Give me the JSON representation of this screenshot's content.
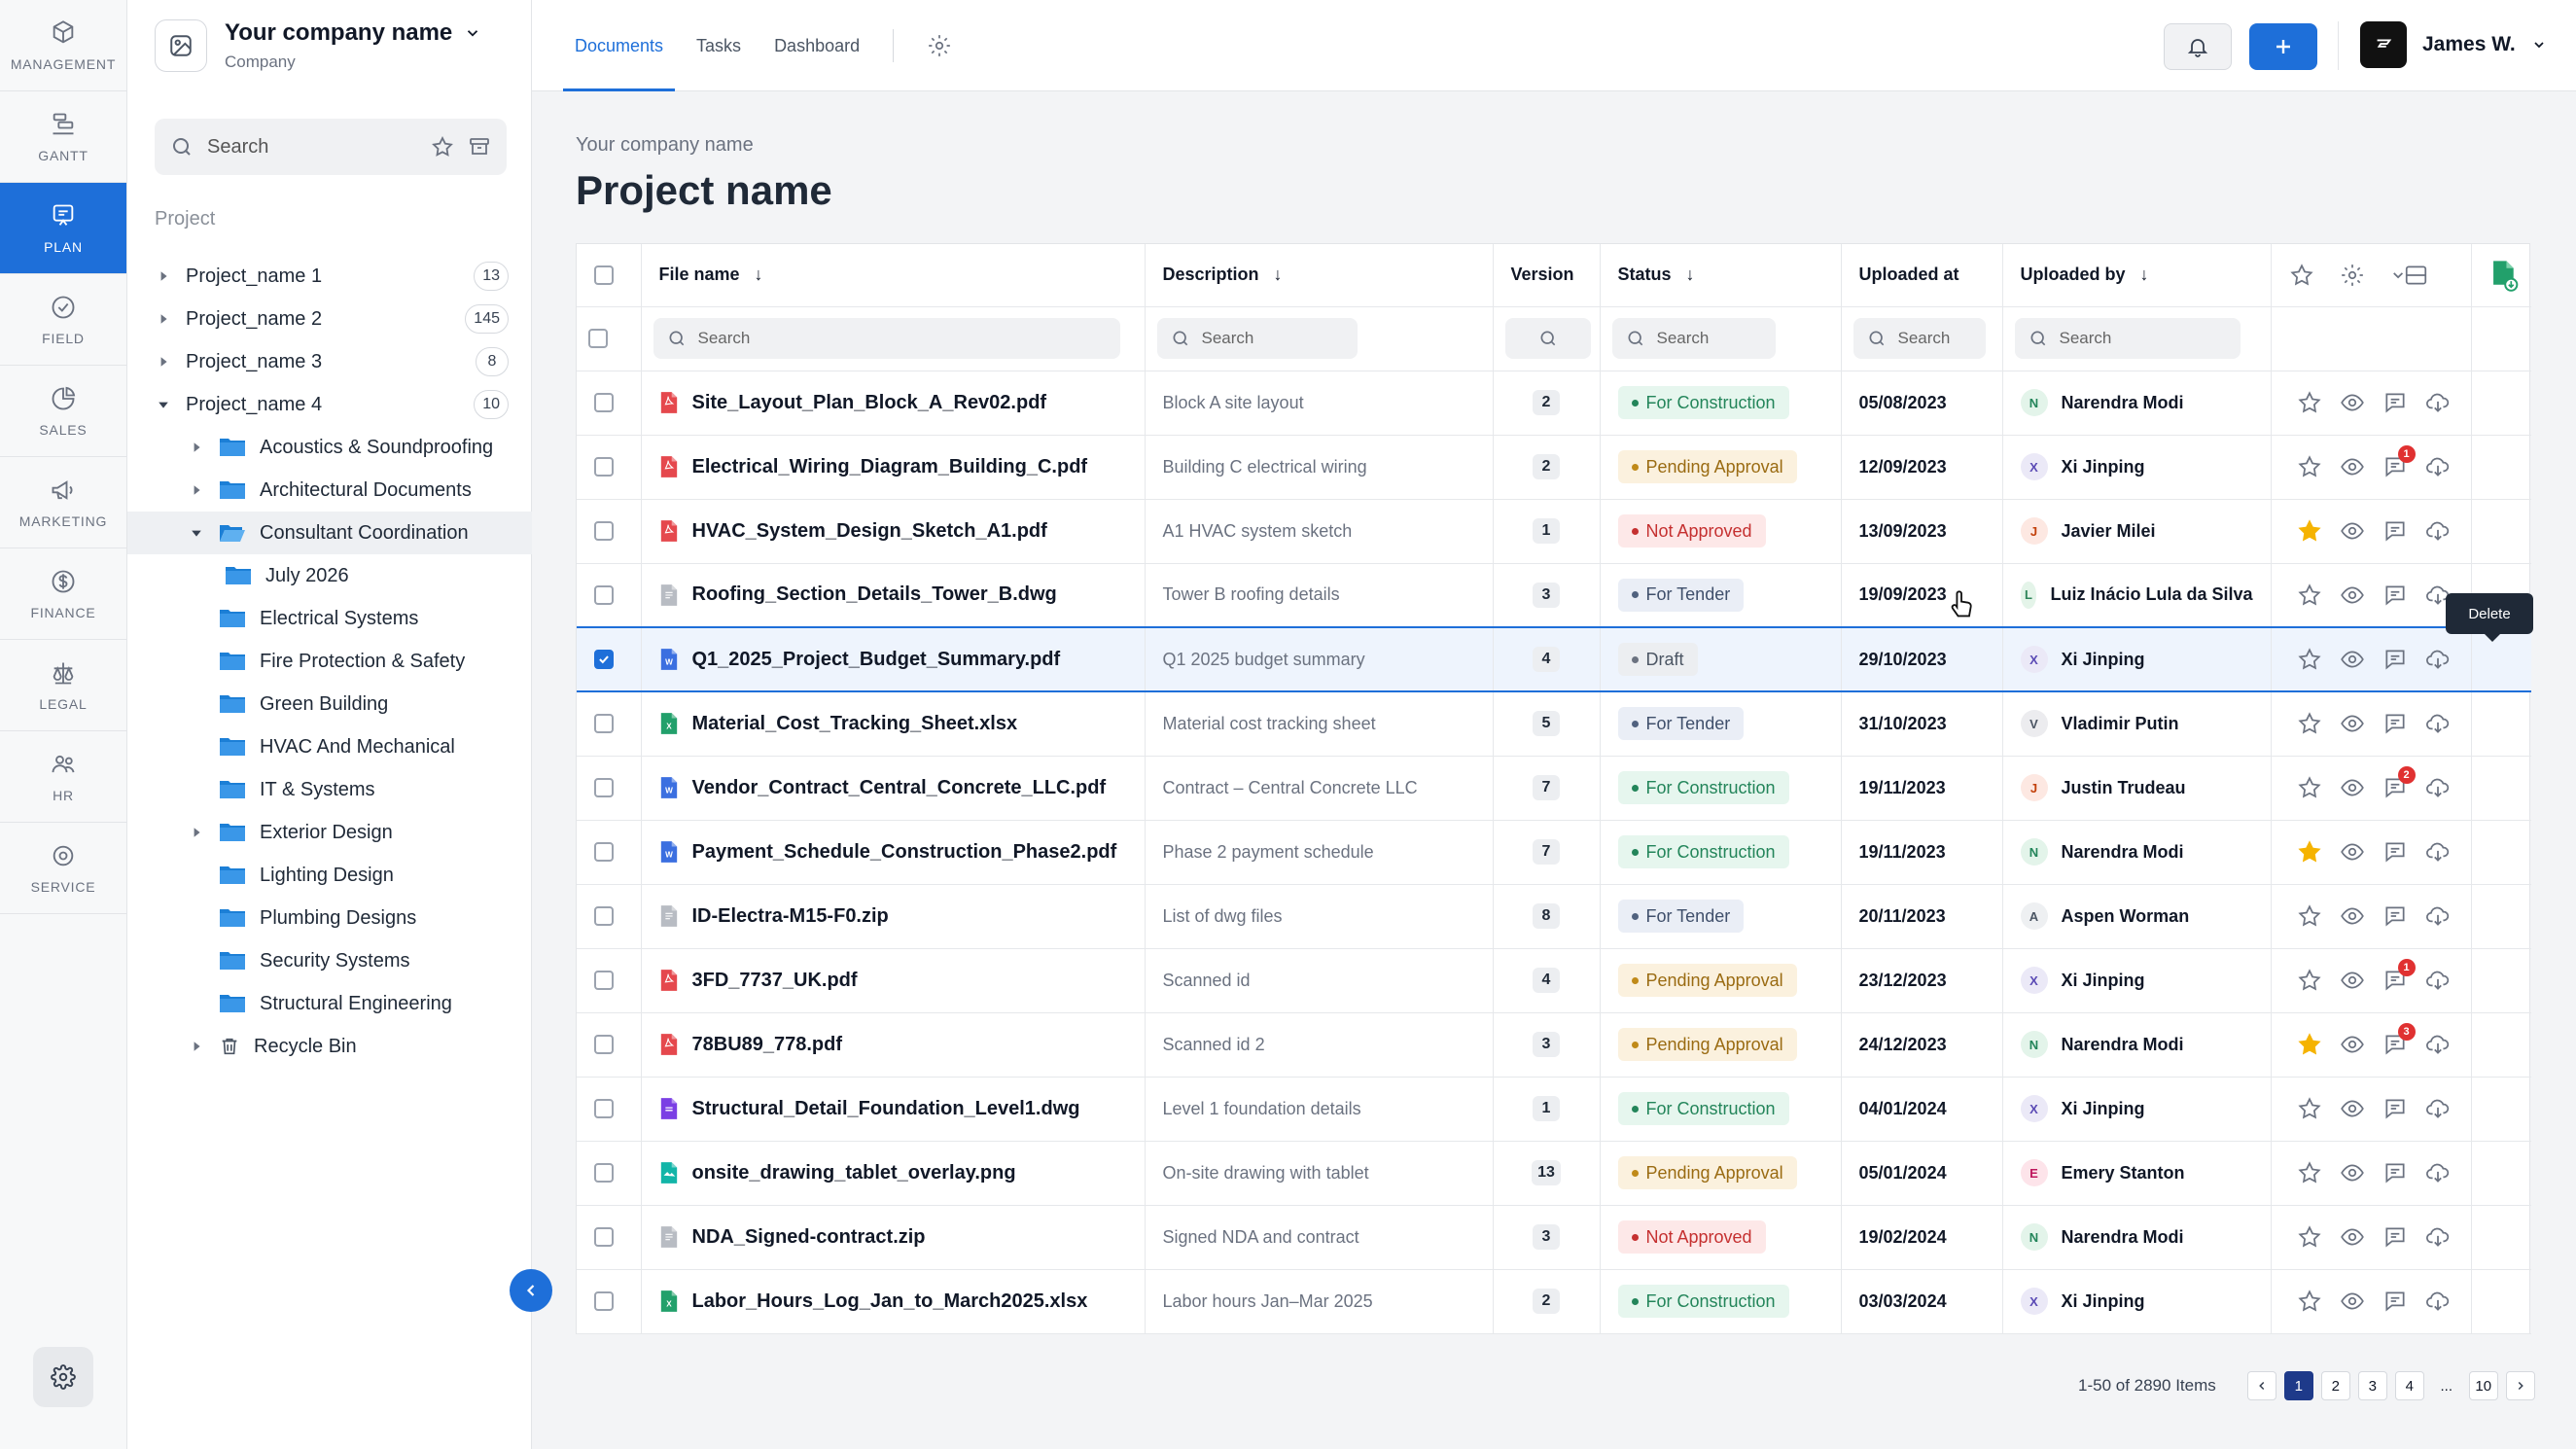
{
  "rail": {
    "items": [
      {
        "label": "MANAGEMENT",
        "icon": "cube-icon"
      },
      {
        "label": "GANTT",
        "icon": "gantt-icon"
      },
      {
        "label": "PLAN",
        "icon": "plan-icon",
        "active": true
      },
      {
        "label": "FIELD",
        "icon": "check-circle-icon"
      },
      {
        "label": "SALES",
        "icon": "pie-icon"
      },
      {
        "label": "MARKETING",
        "icon": "megaphone-icon"
      },
      {
        "label": "FINANCE",
        "icon": "dollar-icon"
      },
      {
        "label": "LEGAL",
        "icon": "scale-icon"
      },
      {
        "label": "HR",
        "icon": "people-icon"
      },
      {
        "label": "SERVICE",
        "icon": "gear-icon"
      }
    ]
  },
  "company": {
    "name": "Your company name",
    "sub": "Company"
  },
  "tree": {
    "search_placeholder": "Search",
    "section_label": "Project",
    "nodes": [
      {
        "label": "Project_name 1",
        "count": "13",
        "level": 0,
        "caret": "right",
        "type": "project"
      },
      {
        "label": "Project_name 2",
        "count": "145",
        "level": 0,
        "caret": "right",
        "type": "project"
      },
      {
        "label": "Project_name 3",
        "count": "8",
        "level": 0,
        "caret": "right",
        "type": "project"
      },
      {
        "label": "Project_name 4",
        "count": "10",
        "level": 0,
        "caret": "down",
        "type": "project"
      },
      {
        "label": "Acoustics & Soundproofing",
        "level": 1,
        "caret": "right",
        "type": "folder"
      },
      {
        "label": "Architectural Documents",
        "level": 1,
        "caret": "right",
        "type": "folder"
      },
      {
        "label": "Consultant Coordination",
        "level": 1,
        "caret": "down",
        "type": "folder-open",
        "selected": true
      },
      {
        "label": "July 2026",
        "level": 2,
        "caret": "",
        "type": "folder"
      },
      {
        "label": "Electrical Systems",
        "level": 1,
        "caret": "",
        "type": "folder"
      },
      {
        "label": "Fire Protection & Safety",
        "level": 1,
        "caret": "",
        "type": "folder"
      },
      {
        "label": "Green Building",
        "level": 1,
        "caret": "",
        "type": "folder"
      },
      {
        "label": "HVAC And Mechanical",
        "level": 1,
        "caret": "",
        "type": "folder"
      },
      {
        "label": "IT & Systems",
        "level": 1,
        "caret": "",
        "type": "folder"
      },
      {
        "label": "Exterior Design",
        "level": 1,
        "caret": "right",
        "type": "folder"
      },
      {
        "label": "Lighting Design",
        "level": 1,
        "caret": "",
        "type": "folder"
      },
      {
        "label": "Plumbing Designs",
        "level": 1,
        "caret": "",
        "type": "folder"
      },
      {
        "label": "Security Systems",
        "level": 1,
        "caret": "",
        "type": "folder"
      },
      {
        "label": "Structural Engineering",
        "level": 1,
        "caret": "",
        "type": "folder"
      },
      {
        "label": "Recycle Bin",
        "level": 1,
        "caret": "right",
        "type": "trash"
      }
    ]
  },
  "topbar": {
    "tabs": [
      "Documents",
      "Tasks",
      "Dashboard"
    ],
    "active_tab": "Documents",
    "user": "James W."
  },
  "page": {
    "breadcrumb": "Your company name",
    "title": "Project name"
  },
  "table": {
    "columns": {
      "file": "File name",
      "desc": "Description",
      "version": "Version",
      "status": "Status",
      "uploaded_at": "Uploaded at",
      "uploaded_by": "Uploaded by"
    },
    "search_placeholder": "Search",
    "tooltip": "Delete",
    "rows": [
      {
        "file": "Site_Layout_Plan_Block_A_Rev02.pdf",
        "ftype": "pdf",
        "desc": "Block A site layout",
        "version": "2",
        "status": "For Construction",
        "sclass": "construction",
        "date": "05/08/2023",
        "initial": "N",
        "user": "Narendra Modi",
        "starred": false,
        "notif": ""
      },
      {
        "file": "Electrical_Wiring_Diagram_Building_C.pdf",
        "ftype": "pdf",
        "desc": "Building C electrical wiring",
        "version": "2",
        "status": "Pending Approval",
        "sclass": "pending",
        "date": "12/09/2023",
        "initial": "X",
        "user": "Xi Jinping",
        "starred": false,
        "notif": "1"
      },
      {
        "file": "HVAC_System_Design_Sketch_A1.pdf",
        "ftype": "pdf",
        "desc": "A1 HVAC system sketch",
        "version": "1",
        "status": "Not Approved",
        "sclass": "not",
        "date": "13/09/2023",
        "initial": "J",
        "user": "Javier Milei",
        "starred": true,
        "notif": ""
      },
      {
        "file": "Roofing_Section_Details_Tower_B.dwg",
        "ftype": "file",
        "desc": "Tower B roofing details",
        "version": "3",
        "status": "For Tender",
        "sclass": "tender",
        "date": "19/09/2023",
        "initial": "L",
        "user": "Luiz Inácio Lula da Silva",
        "starred": false,
        "notif": ""
      },
      {
        "file": "Q1_2025_Project_Budget_Summary.pdf",
        "ftype": "word",
        "desc": "Q1 2025 budget summary",
        "version": "4",
        "status": "Draft",
        "sclass": "draft",
        "date": "29/10/2023",
        "initial": "X",
        "user": "Xi Jinping",
        "starred": false,
        "notif": "",
        "selected": true
      },
      {
        "file": "Material_Cost_Tracking_Sheet.xlsx",
        "ftype": "excel",
        "desc": "Material cost tracking sheet",
        "version": "5",
        "status": "For Tender",
        "sclass": "tender",
        "date": "31/10/2023",
        "initial": "V",
        "user": "Vladimir Putin",
        "starred": false,
        "notif": ""
      },
      {
        "file": "Vendor_Contract_Central_Concrete_LLC.pdf",
        "ftype": "word",
        "desc": "Contract – Central Concrete LLC",
        "version": "7",
        "status": "For Construction",
        "sclass": "construction",
        "date": "19/11/2023",
        "initial": "J",
        "user": "Justin Trudeau",
        "starred": false,
        "notif": "2"
      },
      {
        "file": "Payment_Schedule_Construction_Phase2.pdf",
        "ftype": "word",
        "desc": "Phase 2 payment schedule",
        "version": "7",
        "status": "For Construction",
        "sclass": "construction",
        "date": "19/11/2023",
        "initial": "N",
        "user": "Narendra Modi",
        "starred": true,
        "notif": ""
      },
      {
        "file": "ID-Electra-M15-F0.zip",
        "ftype": "file",
        "desc": "List of dwg files",
        "version": "8",
        "status": "For Tender",
        "sclass": "tender",
        "date": "20/11/2023",
        "initial": "A",
        "user": "Aspen Worman",
        "starred": false,
        "notif": ""
      },
      {
        "file": "3FD_7737_UK.pdf",
        "ftype": "pdf",
        "desc": "Scanned id",
        "version": "4",
        "status": "Pending Approval",
        "sclass": "pending",
        "date": "23/12/2023",
        "initial": "X",
        "user": "Xi Jinping",
        "starred": false,
        "notif": "1"
      },
      {
        "file": "78BU89_778.pdf",
        "ftype": "pdf",
        "desc": "Scanned id 2",
        "version": "3",
        "status": "Pending Approval",
        "sclass": "pending",
        "date": "24/12/2023",
        "initial": "N",
        "user": "Narendra Modi",
        "starred": true,
        "notif": "3"
      },
      {
        "file": "Structural_Detail_Foundation_Level1.dwg",
        "ftype": "purple",
        "desc": "Level 1 foundation details",
        "version": "1",
        "status": "For Construction",
        "sclass": "construction",
        "date": "04/01/2024",
        "initial": "X",
        "user": "Xi Jinping",
        "starred": false,
        "notif": ""
      },
      {
        "file": "onsite_drawing_tablet_overlay.png",
        "ftype": "image",
        "desc": "On-site drawing with tablet",
        "version": "13",
        "status": "Pending Approval",
        "sclass": "pending",
        "date": "05/01/2024",
        "initial": "E",
        "user": "Emery Stanton",
        "starred": false,
        "notif": ""
      },
      {
        "file": "NDA_Signed-contract.zip",
        "ftype": "file",
        "desc": "Signed NDA and contract",
        "version": "3",
        "status": "Not Approved",
        "sclass": "not",
        "date": "19/02/2024",
        "initial": "N",
        "user": "Narendra Modi",
        "starred": false,
        "notif": ""
      },
      {
        "file": "Labor_Hours_Log_Jan_to_March2025.xlsx",
        "ftype": "excel",
        "desc": "Labor hours Jan–Mar 2025",
        "version": "2",
        "status": "For Construction",
        "sclass": "construction",
        "date": "03/03/2024",
        "initial": "X",
        "user": "Xi Jinping",
        "starred": false,
        "notif": ""
      }
    ]
  },
  "pager": {
    "info": "1-50 of 2890 Items",
    "pages": [
      "1",
      "2",
      "3",
      "4",
      "...",
      "10"
    ],
    "active": "1"
  },
  "colors": {
    "accent": "#1e6fd9",
    "pdf": "#e5484d",
    "word": "#3b6fe0",
    "excel": "#22a06b",
    "file": "#b8bcc3",
    "purple": "#7b3fe4",
    "image": "#12b5a8"
  }
}
